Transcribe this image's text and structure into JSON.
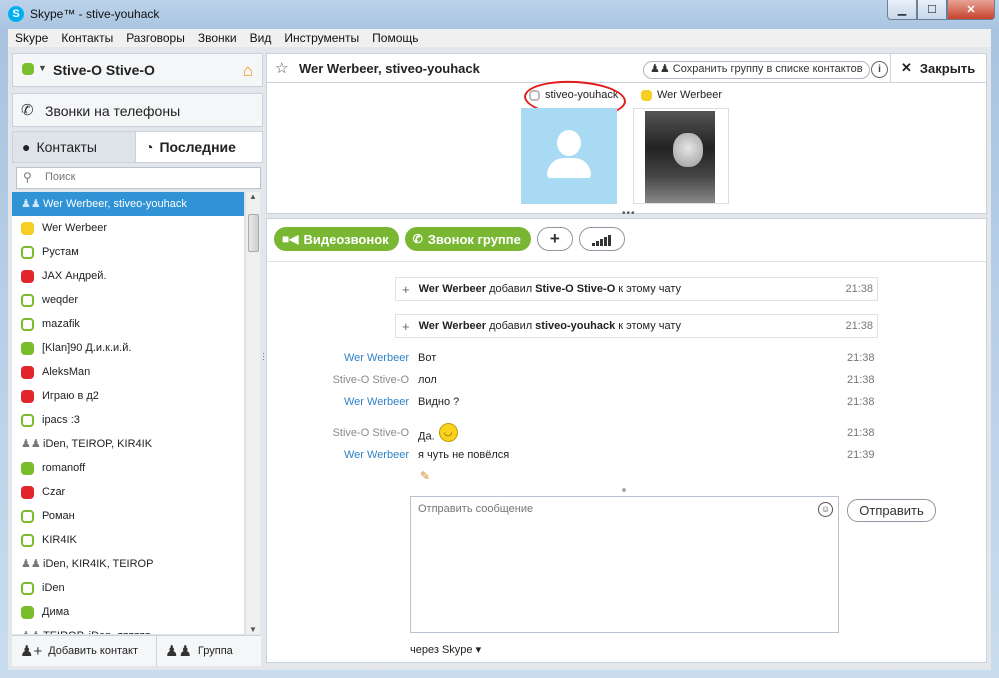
{
  "window": {
    "title": "Skype™ - stive-youhack",
    "logo_letter": "S",
    "controls": {
      "minimize": "▁",
      "maximize": "☐",
      "close": "✕"
    }
  },
  "menu": [
    "Skype",
    "Контакты",
    "Разговоры",
    "Звонки",
    "Вид",
    "Инструменты",
    "Помощь"
  ],
  "profile": {
    "name": "Stive-O Stive-O",
    "status_color": "#7cbf2e",
    "home_icon": "home-icon"
  },
  "calls_label": "Звонки на телефоны",
  "tabs": {
    "contacts": "Контакты",
    "recent": "Последние"
  },
  "search": {
    "placeholder": "Поиск"
  },
  "contacts": [
    {
      "name": "Wer Werbeer, stiveo-youhack",
      "status": "group",
      "selected": true
    },
    {
      "name": "Wer Werbeer",
      "status": "away"
    },
    {
      "name": "Рустам",
      "status": "offline"
    },
    {
      "name": "JAX Андрей.",
      "status": "dnd"
    },
    {
      "name": "weqder",
      "status": "offline"
    },
    {
      "name": "mazafik",
      "status": "offline"
    },
    {
      "name": "[Klan]90 Д.и.к.и.й.",
      "status": "online"
    },
    {
      "name": "AleksMan",
      "status": "dnd"
    },
    {
      "name": "Играю в д2",
      "status": "dnd"
    },
    {
      "name": "ipacs :3",
      "status": "offline"
    },
    {
      "name": "iDen, TEIROP, KIR4IK",
      "status": "group"
    },
    {
      "name": "romanoff",
      "status": "online"
    },
    {
      "name": "Czar",
      "status": "dnd"
    },
    {
      "name": "Роман",
      "status": "offline"
    },
    {
      "name": "KIR4IK",
      "status": "offline"
    },
    {
      "name": "iDen, KIR4IK, TEIROP",
      "status": "group"
    },
    {
      "name": "iDen",
      "status": "offline"
    },
    {
      "name": "Дима",
      "status": "online"
    },
    {
      "name": "TEIROP, iDen, zzzzzz",
      "status": "group"
    }
  ],
  "bottom": {
    "add_contact": "Добавить контакт",
    "group": "Группа"
  },
  "chat": {
    "title": "Wer Werbeer, stiveo-youhack",
    "save_group": "Сохранить группу в списке контактов",
    "info": "i",
    "close": "Закрыть",
    "participants": [
      {
        "name": "stiveo-youhack",
        "status": "offline",
        "avatar": "default-avatar"
      },
      {
        "name": "Wer Werbeer",
        "status": "away",
        "avatar": "photo-avatar"
      }
    ],
    "buttons": {
      "video": "Видеозвонок",
      "group_call": "Звонок группе",
      "add": "+"
    },
    "system_messages": [
      {
        "actor": "Wer Werbeer",
        "verb": "добавил",
        "target": "Stive-O Stive-O",
        "suffix": "к этому чату",
        "time": "21:38"
      },
      {
        "actor": "Wer Werbeer",
        "verb": "добавил",
        "target": "stiveo-youhack",
        "suffix": "к этому чату",
        "time": "21:38"
      }
    ],
    "messages": [
      {
        "sender": "Wer Werbeer",
        "text": "Вот",
        "time": "21:38",
        "self": false
      },
      {
        "sender": "Stive-O Stive-O",
        "text": "лол",
        "time": "21:38",
        "self": true
      },
      {
        "sender": "Wer Werbeer",
        "text": "Видно ?",
        "time": "21:38",
        "self": false
      },
      {
        "sender": "Stive-O Stive-O",
        "text": "Да.",
        "time": "21:38",
        "self": true,
        "emoticon": "laugh"
      },
      {
        "sender": "Wer Werbeer",
        "text": "я чуть не повёлся",
        "time": "21:39",
        "self": false
      }
    ],
    "composer": {
      "placeholder": "Отправить сообщение",
      "send": "Отправить",
      "via": "через Skype"
    }
  },
  "colors": {
    "accent": "#2f93d6",
    "green": "#79b733",
    "online": "#79bd2b",
    "dnd": "#e2242b",
    "away": "#f7ce22",
    "annotation": "#e31a1a"
  }
}
